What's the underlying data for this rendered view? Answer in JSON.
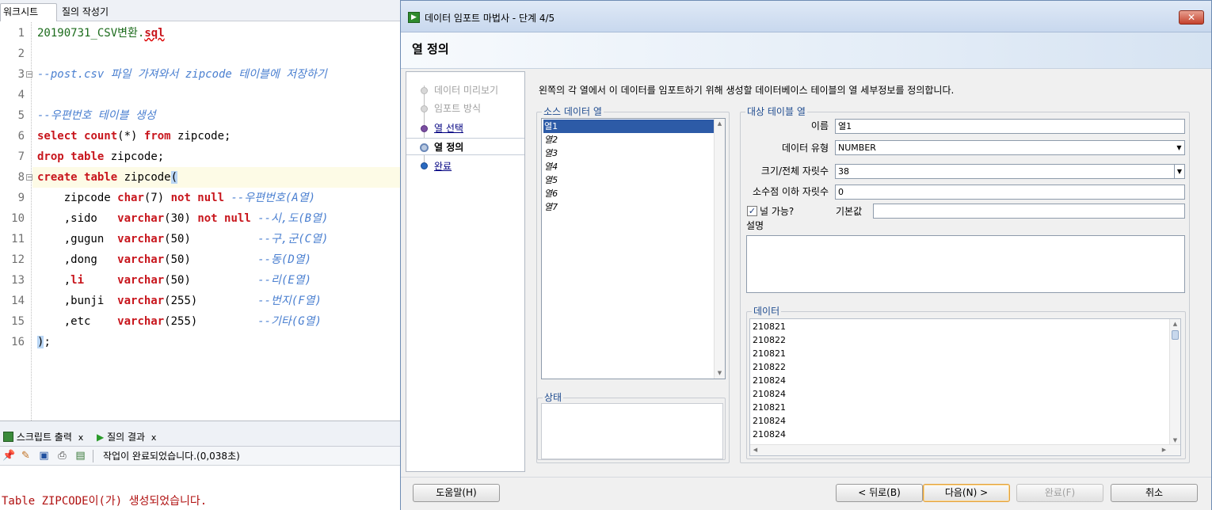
{
  "editor": {
    "tabs": [
      "워크시트",
      "질의 작성기"
    ],
    "line_numbers": [
      "1",
      "2",
      "3",
      "4",
      "5",
      "6",
      "7",
      "8",
      "9",
      "10",
      "11",
      "12",
      "13",
      "14",
      "15",
      "16"
    ],
    "lines": {
      "l1_prefix": "20190731_CSV변환.",
      "l1_ext": "sql",
      "l3": "--post.csv 파일 가져와서 zipcode 테이블에 저장하기",
      "l5": "--우편번호 테이블 생성",
      "l6_kw1": "select",
      "l6_fn": "count",
      "l6_mid": "(*) ",
      "l6_kw2": "from",
      "l6_rest": " zipcode;",
      "l7_kw1": "drop",
      "l7_kw2": "table",
      "l7_rest": " zipcode;",
      "l8_kw1": "create",
      "l8_kw2": "table",
      "l8_rest": " zipcode",
      "l8_paren": "(",
      "l9_col": "    zipcode ",
      "l9_type": "char",
      "l9_size": "(7) ",
      "l9_kw": "not null",
      "l9_cm": " --우편번호(A열)",
      "l10_col": "    ,sido   ",
      "l10_type": "varchar",
      "l10_size": "(30) ",
      "l10_kw": "not null",
      "l10_cm": " --시,도(B열)",
      "l11_col": "    ,gugun  ",
      "l11_type": "varchar",
      "l11_size": "(50)          ",
      "l11_cm": "--구,군(C열)",
      "l12_col": "    ,dong   ",
      "l12_type": "varchar",
      "l12_size": "(50)          ",
      "l12_cm": "--동(D열)",
      "l13_col": "    ,",
      "l13_li": "li",
      "l13_sp": "     ",
      "l13_type": "varchar",
      "l13_size": "(50)          ",
      "l13_cm": "--리(E열)",
      "l14_col": "    ,bunji  ",
      "l14_type": "varchar",
      "l14_size": "(255)         ",
      "l14_cm": "--번지(F열)",
      "l15_col": "    ,etc    ",
      "l15_type": "varchar",
      "l15_size": "(255)         ",
      "l15_cm": "--기타(G열)",
      "l16_paren": ")",
      "l16_rest": ";"
    }
  },
  "output": {
    "tabs": [
      "스크립트 출력",
      "질의 결과"
    ],
    "tab_close": "x",
    "status": "작업이 완료되었습니다.(0,038초)",
    "message": "Table ZIPCODE이(가) 생성되었습니다."
  },
  "dialog": {
    "title": "데이터 임포트 마법사 - 단계 4/5",
    "close_glyph": "✕",
    "heading": "열 정의",
    "steps": [
      {
        "label": "데이터 미리보기",
        "state": "disabled"
      },
      {
        "label": "임포트 방식",
        "state": "disabled"
      },
      {
        "label": "열 선택",
        "state": "link"
      },
      {
        "label": "열 정의",
        "state": "current"
      },
      {
        "label": "완료",
        "state": "link"
      }
    ],
    "instruction": "왼쪽의 각 열에서 이 데이터를 임포트하기 위해 생성할 데이터베이스 테이블의 열 세부정보를 정의합니다.",
    "source_group_label": "소스 데이터 열",
    "source_columns": [
      "열1",
      "열2",
      "열3",
      "열4",
      "열5",
      "열6",
      "열7"
    ],
    "status_group_label": "상태",
    "target_group_label": "대상 테이블 열",
    "fields": {
      "name_label": "이름",
      "name_value": "열1",
      "type_label": "데이터 유형",
      "type_value": "NUMBER",
      "size_label": "크기/전체 자릿수",
      "size_value": "38",
      "scale_label": "소수점 이하 자릿수",
      "scale_value": "0",
      "nullable_label": "널 가능?",
      "nullable_checked": true,
      "default_label": "기본값",
      "default_value": "",
      "desc_label": "설명"
    },
    "data_group_label": "데이터",
    "data_values": [
      "210821",
      "210822",
      "210821",
      "210822",
      "210824",
      "210824",
      "210821",
      "210824",
      "210824"
    ],
    "buttons": {
      "help": "도움말(H)",
      "back": "< 뒤로(B)",
      "next": "다음(N) >",
      "finish": "완료(F)",
      "cancel": "취소"
    }
  },
  "colors": {
    "keyword": "#c8161d",
    "comment": "#4a7fd0",
    "selection": "#2d5ba7",
    "nav_link": "#000080",
    "output_text": "#b01010"
  }
}
